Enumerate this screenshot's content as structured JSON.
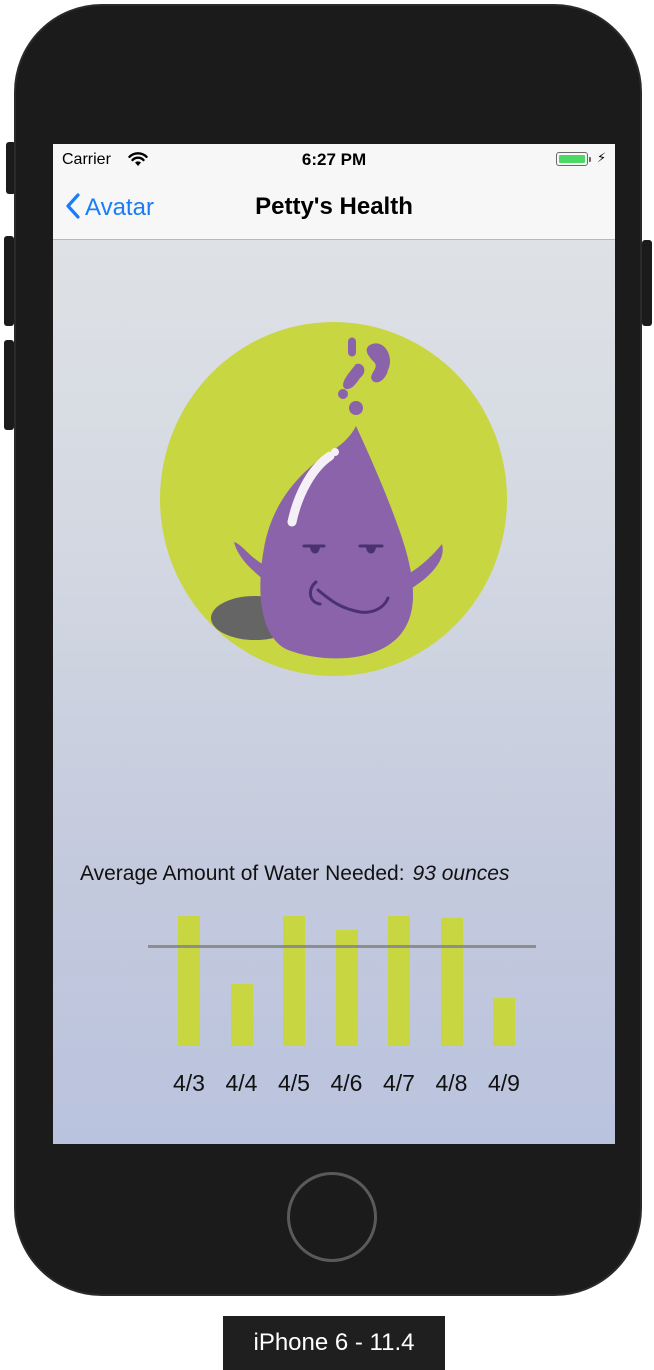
{
  "status_bar": {
    "carrier": "Carrier",
    "time": "6:27 PM",
    "battery_level": 1.0,
    "charging_icon": "bolt-icon",
    "wifi_icon": "wifi-icon"
  },
  "nav": {
    "back_label": "Avatar",
    "back_icon": "chevron-left-icon",
    "title": "Petty's Health"
  },
  "avatar": {
    "icon": "purple-drop-character-icon",
    "circle_color": "#c8d641",
    "body_color": "#8b63aa"
  },
  "water": {
    "label": "Average Amount of Water Needed:",
    "value": "93 ounces"
  },
  "chart_data": {
    "type": "bar",
    "categories": [
      "4/3",
      "4/4",
      "4/5",
      "4/6",
      "4/7",
      "4/8",
      "4/9"
    ],
    "values": [
      130,
      62,
      130,
      116,
      130,
      128,
      48
    ],
    "average_line": 101,
    "ylim": [
      0,
      130
    ],
    "bar_color": "#c8d641",
    "line_color": "#8e8e8e"
  },
  "device": {
    "label": "iPhone 6 - 11.4"
  },
  "colors": {
    "accent": "#1a7df5",
    "battery": "#4cd964"
  }
}
